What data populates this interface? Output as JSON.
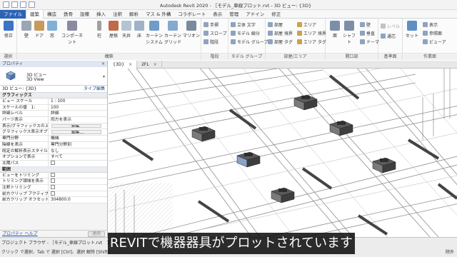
{
  "titlebar": {
    "title": "Autodesk Revit 2020 - ［モデル_車線プロット.rvt - 3D ビュー: {3D}"
  },
  "menu": {
    "tabs": [
      {
        "label": "ファイル",
        "kind": "file"
      },
      {
        "label": "建築",
        "kind": "active"
      },
      {
        "label": "構造",
        "kind": ""
      },
      {
        "label": "鉄骨",
        "kind": ""
      },
      {
        "label": "設備",
        "kind": ""
      },
      {
        "label": "挿入",
        "kind": ""
      },
      {
        "label": "注釈",
        "kind": ""
      },
      {
        "label": "解析",
        "kind": ""
      },
      {
        "label": "マス & 外構",
        "kind": ""
      },
      {
        "label": "コラボレート",
        "kind": ""
      },
      {
        "label": "表示",
        "kind": ""
      },
      {
        "label": "管理",
        "kind": ""
      },
      {
        "label": "アドイン",
        "kind": ""
      },
      {
        "label": "修正",
        "kind": ""
      }
    ]
  },
  "ribbon": {
    "select_group": "選択",
    "build_group": "構築",
    "circulation_group": "階段",
    "model_group": "モデル グループ",
    "room_group": "部屋/エリア",
    "opening_group": "開口部",
    "datum_group": "基準面",
    "workplane_group": "作業面",
    "modify": "修正",
    "wall": "壁",
    "door": "ドア",
    "window": "窓",
    "component": "コンポーネント",
    "column": "柱",
    "roof": "屋根",
    "ceiling": "天井",
    "floor": "床",
    "curtain_system": "カーテン システム",
    "curtain_grid": "カーテン グリッド",
    "mullion": "マリオン",
    "railing": "手摺",
    "ramp": "スロープ",
    "stair": "階段",
    "model_text": "立体 文字",
    "model_line": "モデル 線分",
    "room": "部屋",
    "room_separator": "部屋 境界",
    "tag_room": "部屋 タグ",
    "area": "エリア",
    "area_boundary": "エリア 境界",
    "tag_area": "エリア タグ",
    "by_face": "面",
    "shaft": "シャフト",
    "wall_opening": "壁",
    "vertical": "垂直",
    "dormer": "ドーマ",
    "level": "レベル",
    "grid": "通芯",
    "set": "セット",
    "show": "表示",
    "ref_plane": "参照面",
    "viewer": "ビューア"
  },
  "properties": {
    "header": "プロパティ",
    "close": "×",
    "type_line1": "3D ビュー",
    "type_line2": "3D View",
    "selector": "3D ビュー: {3D}",
    "edit_type": "タイプ編集",
    "graphics_group": "グラフィックス",
    "rows_graphics": [
      {
        "name": "ビュー スケール",
        "value": "1 : 100",
        "kind": ""
      },
      {
        "name": "スケールの値　1:",
        "value": "100",
        "kind": ""
      },
      {
        "name": "詳細レベル",
        "value": "詳細",
        "kind": ""
      },
      {
        "name": "パーツ表示",
        "value": "両方を表示",
        "kind": ""
      },
      {
        "name": "表示/グラフィックスの上...",
        "value": "編集...",
        "kind": "btn"
      },
      {
        "name": "グラフィックス表示オプション",
        "value": "編集...",
        "kind": "btn"
      },
      {
        "name": "専門分野",
        "value": "機械",
        "kind": ""
      },
      {
        "name": "陰線を表示",
        "value": "専門分野別",
        "kind": ""
      },
      {
        "name": "既定の解析表示スタイル",
        "value": "なし",
        "kind": ""
      },
      {
        "name": "オプションで表示",
        "value": "すべて",
        "kind": ""
      },
      {
        "name": "太陽パス",
        "value": "",
        "kind": "chk"
      }
    ],
    "extents_group": "範囲",
    "rows_extents": [
      {
        "name": "ビューをトリミング",
        "value": "",
        "kind": "chk"
      },
      {
        "name": "トリミング領域を表示",
        "value": "",
        "kind": "chk"
      },
      {
        "name": "注釈トリミング",
        "value": "",
        "kind": "chk"
      },
      {
        "name": "前方クリップ アクティブ",
        "value": "",
        "kind": "chk"
      },
      {
        "name": "前方クリップ オフセット",
        "value": "304800.0",
        "kind": ""
      }
    ],
    "help_link": "プロパティ ヘルプ",
    "apply": "適用"
  },
  "viewtabs": [
    {
      "label": "{3D}",
      "active": true,
      "close": "×"
    },
    {
      "label": "2FL",
      "active": false,
      "close": "×"
    }
  ],
  "statusbar": {
    "browser_tabs": "プロジェクト ブラウザ - ［モデル_車線プロット.rvt　プロパティ",
    "status": "クリック で選択、Tab で 選択 [Ctrl]、選択 解除 [Shift]",
    "right": "除外"
  },
  "caption": "REVITで機器器具がプロットされています"
}
